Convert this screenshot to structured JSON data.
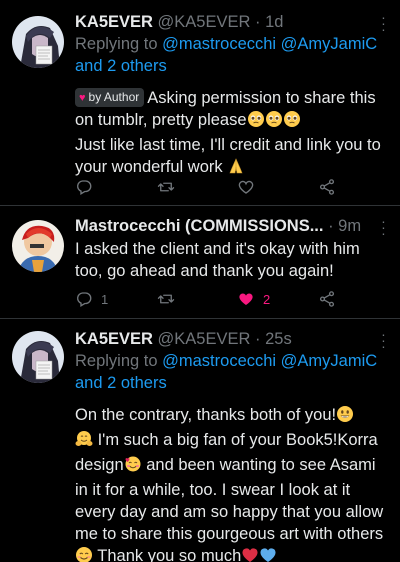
{
  "tweets": [
    {
      "name": "KA5EVER",
      "handle": "@KA5EVER",
      "sep": "·",
      "time": "1d",
      "replying_prefix": "Replying to ",
      "replying_mentions": "@mastrocecchi @AmyJamiC",
      "replying_others": "and 2 others",
      "badge": "by Author",
      "lines": [
        "Asking permission to share this on tumblr, pretty please",
        "Just like last time, I'll credit and link you to your wonderful work"
      ],
      "reply_count": "",
      "retweet_count": "",
      "like_count": ""
    },
    {
      "name": "Mastrocecchi (COMMISSIONS...",
      "sep": "·",
      "time": "9m",
      "text": "I asked the client and it's okay with him too, go ahead and thank you again!",
      "reply_count": "1",
      "retweet_count": "",
      "like_count": "2"
    },
    {
      "name": "KA5EVER",
      "handle": "@KA5EVER",
      "sep": "·",
      "time": "25s",
      "replying_prefix": "Replying to ",
      "replying_mentions": "@mastrocecchi @AmyJamiC",
      "replying_others": "and 2 others",
      "p1": "On the contrary, thanks both of you!",
      "p2": "I'm such a big fan of your Book5!Korra design",
      "p3": "and been wanting to see Asami in it for a while, too. I swear I look at it every day and am so happy that you allow me to share this gourgeous art with others",
      "p4": "Thank you so much"
    }
  ],
  "icons": {
    "reply": "reply-icon",
    "retweet": "retweet-icon",
    "like": "heart-icon",
    "share": "share-icon",
    "more": "more-icon"
  },
  "colors": {
    "background": "#000000",
    "text": "#e7e9ea",
    "muted": "#71767b",
    "link": "#1d9bf0",
    "like": "#f91880"
  }
}
